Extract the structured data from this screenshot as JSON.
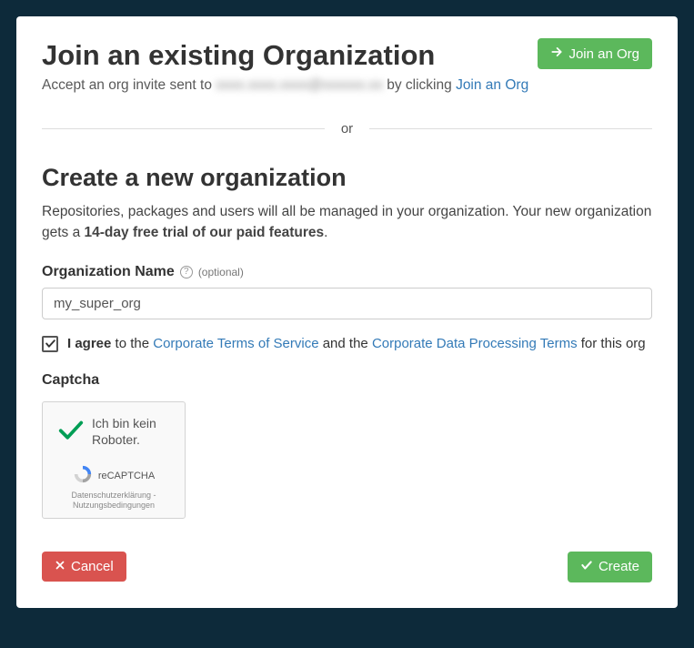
{
  "join": {
    "heading": "Join an existing Organization",
    "subtext_prefix": "Accept an org invite sent to ",
    "email_blurred": "xxxx.xxxx.xxxx@xxxxxx.xx",
    "subtext_mid": " by clicking ",
    "link_text": "Join an Org",
    "button_label": "Join an Org"
  },
  "divider": {
    "text": "or"
  },
  "create": {
    "heading": "Create a new organization",
    "desc_part1": "Repositories, packages and users will all be managed in your organization. Your new organization gets a ",
    "desc_bold": "14-day free trial of our paid features",
    "desc_part2": ".",
    "org_name_label": "Organization Name",
    "optional_text": "(optional)",
    "org_name_value": "my_super_org",
    "agree_bold": "I agree",
    "agree_mid1": " to the ",
    "tos_link": "Corporate Terms of Service",
    "agree_mid2": " and the ",
    "dpt_link": "Corporate Data Processing Terms",
    "agree_tail": " for this org",
    "checkbox_checked": true
  },
  "captcha": {
    "label": "Captcha",
    "main_text": "Ich bin kein Roboter.",
    "brand": "reCAPTCHA",
    "links": "Datenschutzerklärung - Nutzungsbedingungen"
  },
  "footer": {
    "cancel": "Cancel",
    "create": "Create"
  }
}
